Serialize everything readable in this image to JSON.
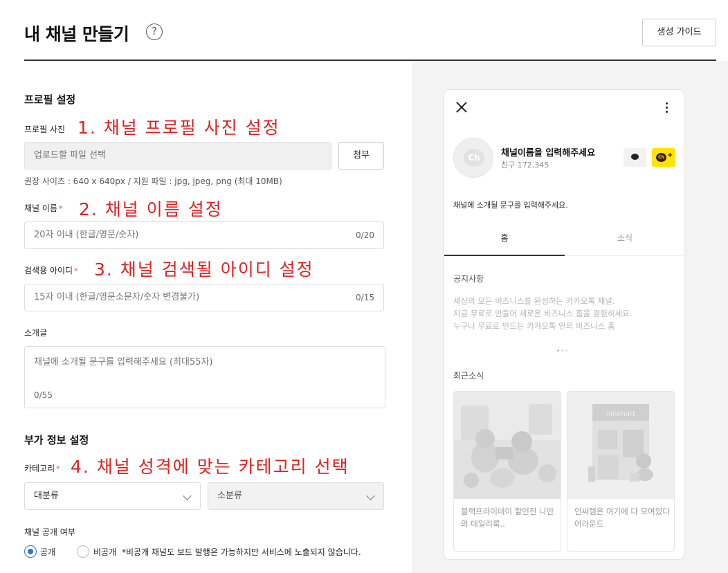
{
  "header": {
    "title": "내 채널 만들기",
    "help_icon": "question-circle-icon",
    "guide_button": "생성 가이드"
  },
  "profile": {
    "section_title": "프로필 설정",
    "photo_label": "프로필 사진",
    "photo_annotation": "1. 채널 프로필 사진 설정",
    "file_placeholder": "업로드할 파일 선택",
    "attach_button": "첨부",
    "hint": "권장 사이즈 : 640 x 640px / 지원 파일 : jpg, jpeg, png (최대 10MB)",
    "name_label": "채널 이름",
    "name_annotation": "2. 채널 이름 설정",
    "name_placeholder": "20자 이내 (한글/영문/숫자)",
    "name_counter": "0/20",
    "search_id_label": "검색용 아이디",
    "search_id_annotation": "3. 채널 검색될 아이디 설정",
    "search_id_placeholder": "15자 이내 (한글/영문소문자/숫자 변경불가)",
    "search_id_counter": "0/15",
    "intro_label": "소개글",
    "intro_placeholder": "채널에 소개될 문구를 입력해주세요 (최대55자)",
    "intro_counter": "0/55",
    "required_mark": "*"
  },
  "extra": {
    "section_title": "부가 정보 설정",
    "category_label": "카테고리",
    "category_annotation": "4. 채널 성격에 맞는 카테고리 선택",
    "major_select": "대분류",
    "minor_select": "소분류",
    "visibility_label": "채널 공개 여부",
    "public_option": "공개",
    "private_option": "비공개",
    "private_note": "*비공개 채널도 보드 발행은 가능하지만 서비스에 노출되지 않습니다.",
    "selected": "공개"
  },
  "preview": {
    "avatar_text": "Ch",
    "channel_name": "채널이름을 입력해주세요",
    "friends": "친구 172,345",
    "add_badge": "Ch",
    "add_plus": "+",
    "intro": "채널에 소개될 문구를 입력해주세요.",
    "tabs": [
      "홈",
      "소식"
    ],
    "notice_title": "공지사항",
    "notice_lines": [
      "세상의 모든 비즈니스를 완성하는 카카오톡 채널.",
      "지금 무료로 만들어 새로운 비즈니스 홈을 경험하세요.",
      "누구나 무료로 만드는 카카오톡 안의 비즈니스 홈"
    ],
    "recent_title": "최근소식",
    "cards": [
      {
        "text": "블랙프라이데이 할인전 나만의 데일리룩.."
      },
      {
        "text": "인싸템은 여기에 다 모여있다 어라운드",
        "sign": "ninimart"
      }
    ]
  },
  "colors": {
    "annotation": "#e02020",
    "radio_selected": "#2f6fd8",
    "kakao_yellow": "#fee500"
  }
}
